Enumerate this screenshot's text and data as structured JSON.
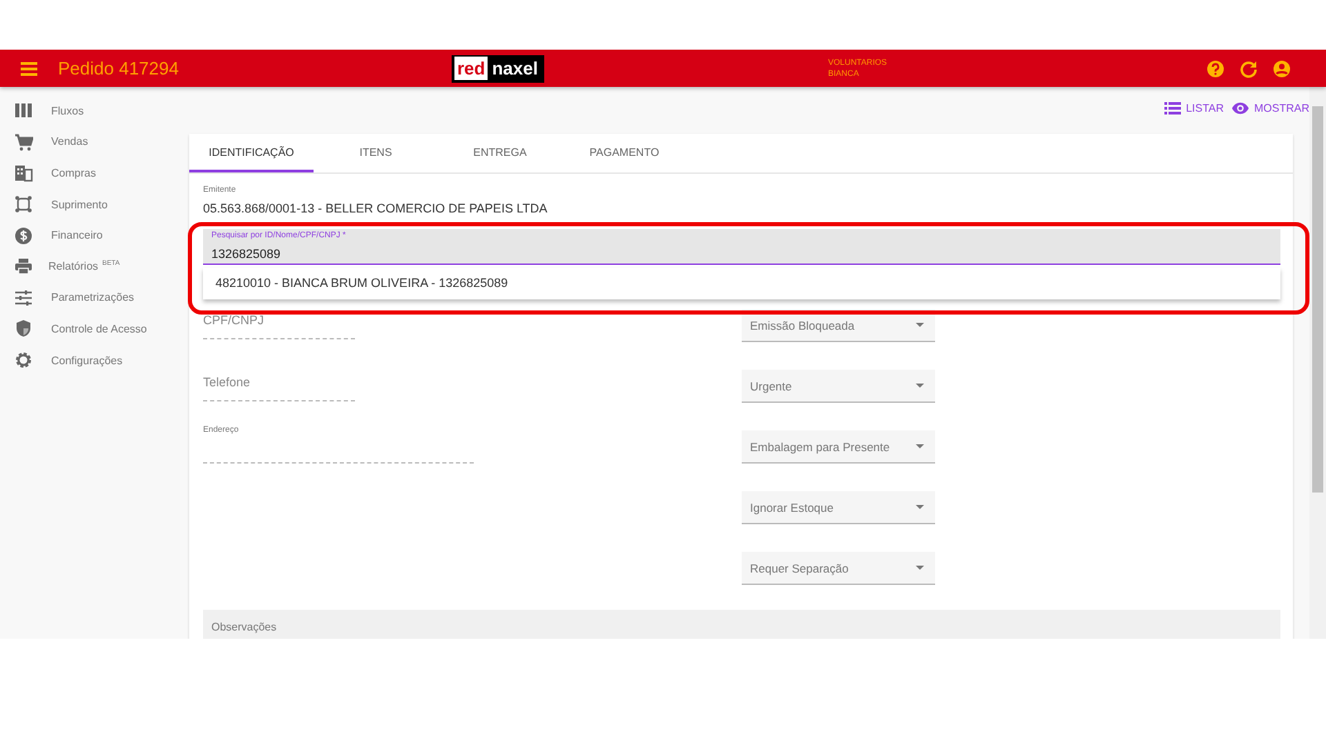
{
  "app_bar": {
    "title": "Pedido 417294",
    "logo": {
      "part_1": "red",
      "part_2": "naxel"
    },
    "user": {
      "line_1": "VOLUNTARIOS",
      "line_2": "BIANCA"
    },
    "icons": [
      {
        "kind": "help"
      },
      {
        "kind": "refresh"
      },
      {
        "kind": "account"
      }
    ]
  },
  "sidebar": {
    "items": [
      {
        "label": "Fluxos",
        "kind": "columns"
      },
      {
        "label": "Vendas",
        "kind": "cart"
      },
      {
        "label": "Compras",
        "kind": "building"
      },
      {
        "label": "Suprimento",
        "kind": "frame"
      },
      {
        "label": "Financeiro",
        "kind": "money"
      },
      {
        "label": "Relatórios",
        "badge": "BETA",
        "kind": "printer"
      },
      {
        "label": "Parametrizações",
        "kind": "sliders"
      },
      {
        "label": "Controle de Acesso",
        "kind": "shield"
      },
      {
        "label": "Configurações",
        "kind": "gear"
      }
    ]
  },
  "actions": [
    {
      "label": "LISTAR",
      "kind": "list"
    },
    {
      "label": "MOSTRAR",
      "kind": "eye"
    }
  ],
  "tabs": [
    {
      "label": "IDENTIFICAÇÃO",
      "selected": true
    },
    {
      "label": "ITENS",
      "selected": false
    },
    {
      "label": "ENTREGA",
      "selected": false
    },
    {
      "label": "PAGAMENTO",
      "selected": false
    }
  ],
  "emitente": {
    "label": "Emitente",
    "value": "05.563.868/0001-13 - BELLER COMERCIO DE PAPEIS LTDA"
  },
  "search": {
    "label": "Pesquisar por ID/Nome/CPF/CNPJ *",
    "value": "1326825089",
    "suggestions": [
      "48210010 - BIANCA BRUM OLIVEIRA - 1326825089"
    ]
  },
  "left_fields": [
    {
      "label": "CPF/CNPJ",
      "kind": "placeholder"
    },
    {
      "label": "Telefone",
      "kind": "placeholder"
    },
    {
      "label": "Endereço",
      "kind": "floating"
    }
  ],
  "selects": [
    {
      "label": "Emissão Bloqueada"
    },
    {
      "label": "Urgente"
    },
    {
      "label": "Embalagem para Presente"
    },
    {
      "label": "Ignorar Estoque"
    },
    {
      "label": "Requer Separação"
    }
  ],
  "observacoes": {
    "label": "Observações"
  },
  "annotation": {
    "kind": "highlight"
  }
}
